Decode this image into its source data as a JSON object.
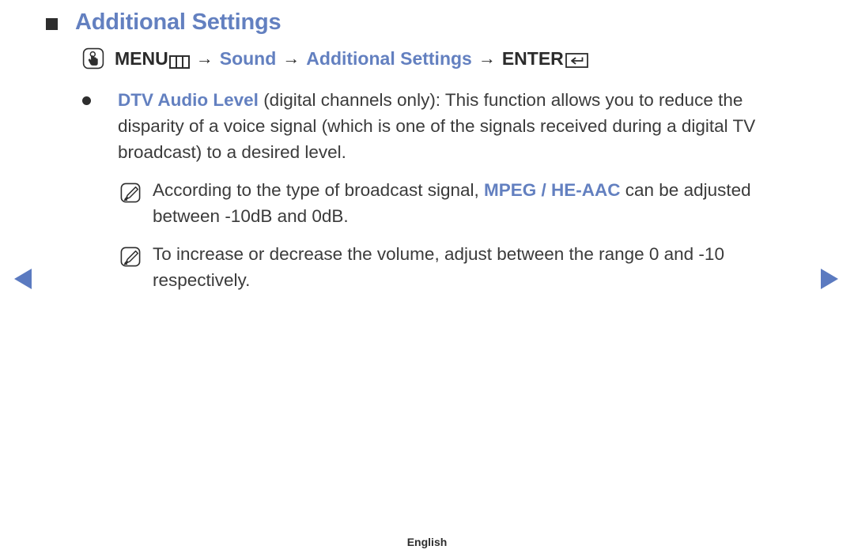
{
  "heading": {
    "bullet_icon": "filled-square-icon",
    "title": "Additional Settings"
  },
  "menu_path": {
    "remote_icon": "hand-press-button-icon",
    "menu_label": "MENU",
    "menu_glyph_icon": "menu-three-columns-icon",
    "arrow1": "→",
    "item1": "Sound",
    "arrow2": "→",
    "item2": "Additional Settings",
    "arrow3": "→",
    "enter_label": "ENTER",
    "enter_glyph_icon": "enter-return-key-icon"
  },
  "body": {
    "bullet": {
      "icon": "bullet-dot-icon",
      "term": "DTV Audio Level",
      "text": " (digital channels only): This function allows you to reduce the disparity of a voice signal (which is one of the signals received during a digital TV broadcast) to a desired level."
    },
    "notes": [
      {
        "icon": "note-pencil-icon",
        "text_before": "According to the type of broadcast signal, ",
        "strong": "MPEG / HE-AAC",
        "text_after": " can be adjusted between -10dB and 0dB."
      },
      {
        "icon": "note-pencil-icon",
        "text_before": "To increase or decrease the volume, adjust between the range 0 and -10 respectively.",
        "strong": "",
        "text_after": ""
      }
    ]
  },
  "navigation": {
    "prev_icon": "triangle-left-icon",
    "next_icon": "triangle-right-icon"
  },
  "footer": {
    "language": "English"
  },
  "colors": {
    "accent_blue": "#6380c0",
    "text_dark": "#3b3b3b",
    "icon_dark": "#2e2e2e"
  }
}
